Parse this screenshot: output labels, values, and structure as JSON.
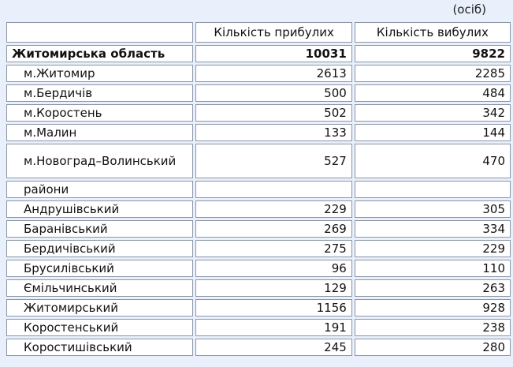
{
  "unit_label": "(осіб)",
  "table": {
    "headers": [
      "",
      "Кількість прибулих",
      "Кількість вибулих"
    ],
    "total": {
      "name": "Житомирська область",
      "arrived": "10031",
      "departed": "9822"
    },
    "cities": [
      {
        "name": "м.Житомир",
        "arrived": "2613",
        "departed": "2285"
      },
      {
        "name": "м.Бердичів",
        "arrived": "500",
        "departed": "484"
      },
      {
        "name": "м.Коростень",
        "arrived": "502",
        "departed": "342"
      },
      {
        "name": "м.Малин",
        "arrived": "133",
        "departed": "144"
      },
      {
        "name": "м.Новоград–Волинський",
        "arrived": "527",
        "departed": "470"
      }
    ],
    "section_label": "райони",
    "districts": [
      {
        "name": "Андрушівський",
        "arrived": "229",
        "departed": "305"
      },
      {
        "name": "Баранівський",
        "arrived": "269",
        "departed": "334"
      },
      {
        "name": "Бердичівський",
        "arrived": "275",
        "departed": "229"
      },
      {
        "name": "Брусилівський",
        "arrived": "96",
        "departed": "110"
      },
      {
        "name": "Ємільчинський",
        "arrived": "129",
        "departed": "263"
      },
      {
        "name": "Житомирський",
        "arrived": "1156",
        "departed": "928"
      },
      {
        "name": "Коростенський",
        "arrived": "191",
        "departed": "238"
      },
      {
        "name": "Коростишівський",
        "arrived": "245",
        "departed": "280"
      }
    ]
  }
}
